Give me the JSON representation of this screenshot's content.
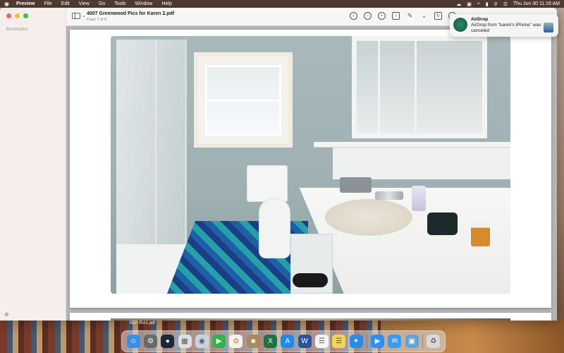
{
  "menubar": {
    "apple": "",
    "items": [
      "Preview",
      "File",
      "Edit",
      "View",
      "Go",
      "Tools",
      "Window",
      "Help"
    ],
    "clock": "Thu Jun 30  11:16 AM"
  },
  "sidebar": {
    "section_label": "Bookmarks"
  },
  "document": {
    "title": "4007 Greenwood Pics for Karen 2.pdf",
    "subtitle": "Page 7 of 8"
  },
  "toolbar": {
    "icons": [
      "info-icon",
      "zoom-out-icon",
      "zoom-in-icon",
      "share-icon",
      "markup-pen-icon",
      "rotate-icon",
      "search-icon"
    ]
  },
  "notification": {
    "title": "AirDrop",
    "body": "AirDrop from \"karen's iPhone\" was canceled"
  },
  "desktop": {
    "file_label": "SEP IRA1.pdf"
  },
  "dock": {
    "apps": [
      {
        "name": "finder",
        "color": "#3a8ee6"
      },
      {
        "name": "system-prefs",
        "color": "#6a6a6a"
      },
      {
        "name": "steam",
        "color": "#1b2838"
      },
      {
        "name": "launchpad",
        "color": "#e0e0e0"
      },
      {
        "name": "safari-alt",
        "color": "#c9d4de"
      },
      {
        "name": "facetime",
        "color": "#2fb34c"
      },
      {
        "name": "photos",
        "color": "#f2f2f2"
      },
      {
        "name": "stickies",
        "color": "#a88a5c"
      },
      {
        "name": "excel",
        "color": "#1e7145"
      },
      {
        "name": "app-store",
        "color": "#1a8cf0"
      },
      {
        "name": "word",
        "color": "#2a5699"
      },
      {
        "name": "contacts",
        "color": "#f5f5f5"
      },
      {
        "name": "notes",
        "color": "#f7d64a"
      },
      {
        "name": "safari",
        "color": "#2a8ae6"
      },
      {
        "name": "zoom",
        "color": "#2d8cff"
      },
      {
        "name": "mail",
        "color": "#3b9af3"
      },
      {
        "name": "preview",
        "color": "#5fa3d8"
      },
      {
        "name": "trash",
        "color": "#d9d9d9"
      }
    ]
  }
}
